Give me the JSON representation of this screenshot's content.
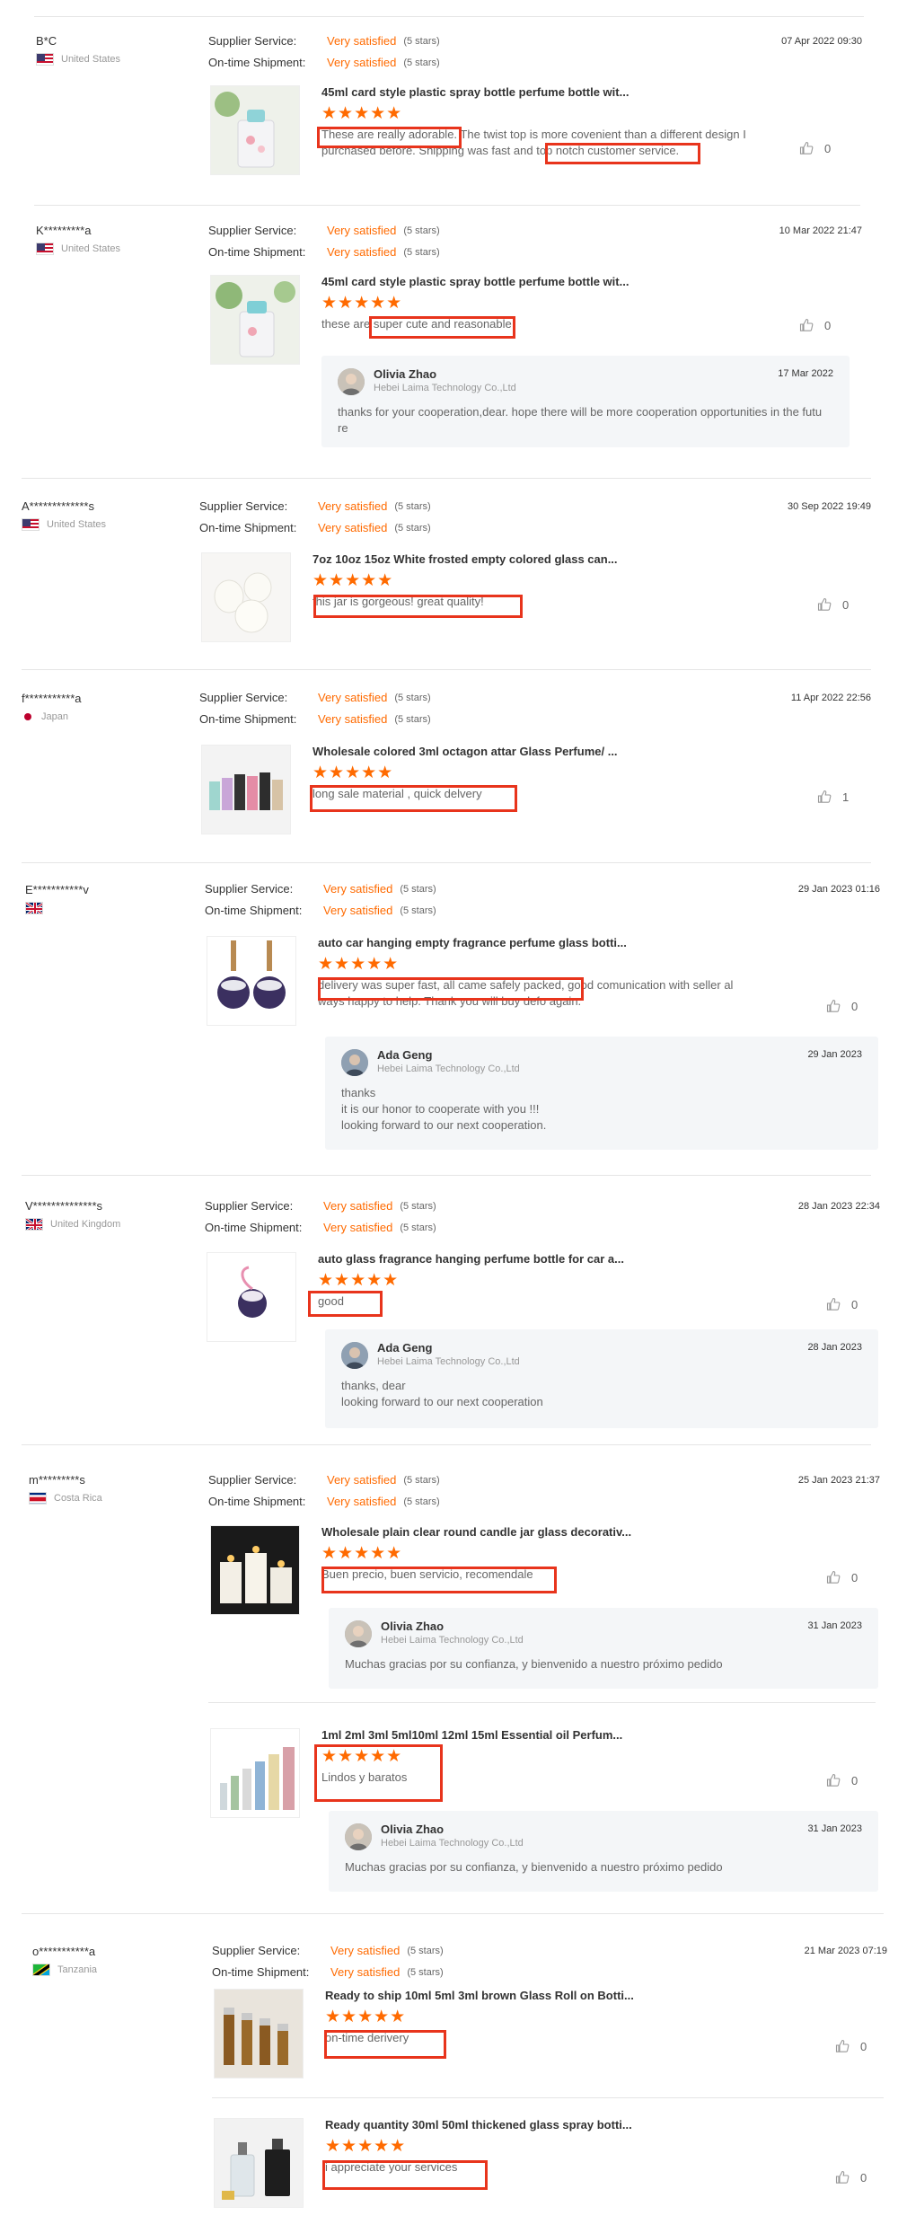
{
  "labels": {
    "supplier_service": "Supplier Service:",
    "on_time_shipment": "On-time Shipment:",
    "satisfied": "Very satisfied",
    "stars_text": "(5 stars)",
    "stars": "★★★★★"
  },
  "colors": {
    "accent": "#ff6a00",
    "highlight": "#e8341c"
  },
  "reviews": [
    {
      "user": "B*C",
      "country": "United States",
      "flag_icon": "us-flag-icon",
      "date": "07 Apr 2022 09:30",
      "items": [
        {
          "title": "45ml card style plastic spray bottle perfume bottle wit...",
          "comment": "These are really adorable. The twist top is more covenient than a different design I purchased before. Shipping was fast and top notch customer service.",
          "likes": "0"
        }
      ]
    },
    {
      "user": "K*********a",
      "country": "United States",
      "flag_icon": "us-flag-icon",
      "date": "10 Mar 2022 21:47",
      "items": [
        {
          "title": "45ml card style plastic spray bottle perfume bottle wit...",
          "comment": "these are super cute and reasonable",
          "likes": "0",
          "reply": {
            "name": "Olivia Zhao",
            "company": "Hebei Laima Technology Co.,Ltd",
            "date": "17 Mar 2022",
            "text": "thanks for your cooperation,dear. hope there will be more cooperation opportunities in the futu\nre"
          }
        }
      ]
    },
    {
      "user": "A*************s",
      "country": "United States",
      "flag_icon": "us-flag-icon",
      "date": "30 Sep 2022 19:49",
      "items": [
        {
          "title": "7oz 10oz 15oz White frosted empty colored glass can...",
          "comment": "this jar is gorgeous! great quality!",
          "likes": "0"
        }
      ]
    },
    {
      "user": "f***********a",
      "country": "Japan",
      "flag_icon": "japan-flag-icon",
      "date": "11 Apr 2022 22:56",
      "items": [
        {
          "title": "Wholesale colored 3ml octagon attar Glass Perfume/ ...",
          "comment": "long sale material ,  quick delvery",
          "likes": "1"
        }
      ]
    },
    {
      "user": "E***********v",
      "country": "",
      "flag_icon": "uk-flag-icon",
      "date": "29 Jan 2023 01:16",
      "items": [
        {
          "title": "auto car hanging empty fragrance perfume glass botti...",
          "comment": "delivery was super fast, all came safely packed, good comunication with seller al ways happy to help. Thank you will buy defo again.",
          "likes": "0",
          "reply": {
            "name": "Ada Geng",
            "company": "Hebei Laima Technology Co.,Ltd",
            "date": "29 Jan 2023",
            "text": "thanks\nit is our honor to cooperate with you !!!\nlooking forward to our next cooperation."
          }
        }
      ]
    },
    {
      "user": "V**************s",
      "country": "United Kingdom",
      "flag_icon": "uk-flag-icon",
      "date": "28 Jan 2023 22:34",
      "items": [
        {
          "title": "auto glass fragrance hanging perfume bottle for car a...",
          "comment": "good",
          "likes": "0",
          "reply": {
            "name": "Ada Geng",
            "company": "Hebei Laima Technology Co.,Ltd",
            "date": "28 Jan 2023",
            "text": "thanks, dear\nlooking forward to our next cooperation"
          }
        }
      ]
    },
    {
      "user": "m*********s",
      "country": "Costa Rica",
      "flag_icon": "costa-rica-flag-icon",
      "date": "25 Jan 2023 21:37",
      "items": [
        {
          "title": "Wholesale plain clear round candle jar glass decorativ...",
          "comment": "Buen precio, buen servicio, recomendale",
          "likes": "0",
          "reply": {
            "name": "Olivia Zhao",
            "company": "Hebei Laima Technology Co.,Ltd",
            "date": "31 Jan 2023",
            "text": "Muchas gracias por su confianza,  y bienvenido a nuestro próximo pedido"
          }
        },
        {
          "title": "1ml 2ml 3ml 5ml10ml 12ml 15ml Essential oil Perfum...",
          "comment": "Lindos y baratos",
          "likes": "0",
          "reply": {
            "name": "Olivia Zhao",
            "company": "Hebei Laima Technology Co.,Ltd",
            "date": "31 Jan 2023",
            "text": "Muchas gracias por su confianza,  y bienvenido a nuestro próximo pedido"
          }
        }
      ]
    },
    {
      "user": "o***********a",
      "country": "Tanzania",
      "flag_icon": "tanzania-flag-icon",
      "date": "21 Mar 2023 07:19",
      "items": [
        {
          "title": "Ready to ship 10ml 5ml 3ml brown Glass Roll on Botti...",
          "comment": "on-time derivery",
          "likes": "0"
        },
        {
          "title": "Ready quantity 30ml 50ml thickened glass spray botti...",
          "comment": "i appreciate your services",
          "likes": "0"
        }
      ]
    }
  ]
}
